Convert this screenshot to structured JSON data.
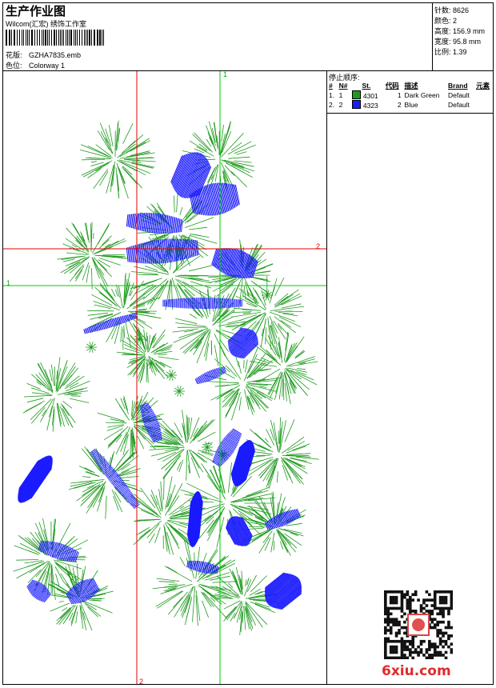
{
  "header": {
    "title": "生产作业图",
    "subtitle": "Wilcom(汇宏) 绣饰工作室",
    "design_label": "花版:",
    "design_value": "GZHA7835.emb",
    "color_label": "色位:",
    "color_value": "Colorway 1"
  },
  "stats": [
    {
      "label": "针数:",
      "value": "8626"
    },
    {
      "label": "颜色:",
      "value": "2"
    },
    {
      "label": "高度:",
      "value": "156.9 mm"
    },
    {
      "label": "宽度:",
      "value": "95.8 mm"
    },
    {
      "label": "比例:",
      "value": "1.39"
    }
  ],
  "stop_sequence": {
    "header": "停止顺序:",
    "columns": [
      "#",
      "N#",
      "St.",
      "代码",
      "描述",
      "Brand",
      "元素"
    ],
    "rows": [
      {
        "idx": "1.",
        "n": "1",
        "stitch": "4301",
        "code": "1",
        "desc": "Dark Green",
        "brand": "Default",
        "color": "#1f9a1f"
      },
      {
        "idx": "2.",
        "n": "2",
        "stitch": "4323",
        "code": "2",
        "desc": "Blue",
        "brand": "Default",
        "color": "#1a1aff"
      }
    ]
  },
  "guides": {
    "top_label": "1",
    "left_label": "1",
    "right_label": "2",
    "bottom_label": "2"
  },
  "watermark": "6xiu.com",
  "colors": {
    "green": "#1f9a1f",
    "blue": "#1a1aff",
    "red_guide": "#e00000",
    "green_guide": "#00cc00"
  }
}
